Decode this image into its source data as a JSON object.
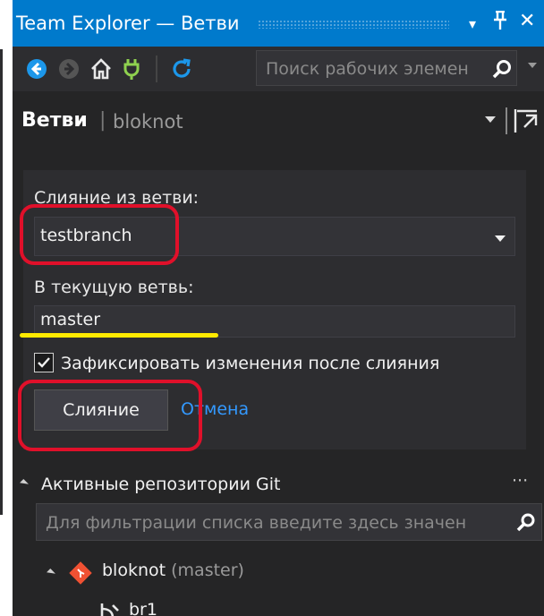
{
  "window": {
    "title": "Team Explorer — Ветви",
    "dropdown_glyph": "▾",
    "pin_glyph": "ᚋ",
    "close_glyph": "✕"
  },
  "toolbar": {
    "search_placeholder": "Поиск рабочих элемен",
    "icons": [
      "back-icon",
      "forward-icon",
      "home-icon",
      "connect-icon",
      "refresh-icon",
      "search-icon"
    ]
  },
  "header": {
    "page_title": "Ветви",
    "separator": "|",
    "repository": "bloknot"
  },
  "merge": {
    "from_label": "Слияние из ветви:",
    "from_value": "testbranch",
    "into_label": "В текущую ветвь:",
    "into_value": "master",
    "commit_checkbox_label": "Зафиксировать изменения после слияния",
    "commit_checked": true,
    "merge_button": "Слияние",
    "cancel_link": "Отмена"
  },
  "repositories": {
    "title": "Активные репозитории Git",
    "more": "···",
    "filter_placeholder": "Для фильтрации списка введите здесь значен",
    "items": [
      {
        "name": "bloknot",
        "current_branch": "(master)"
      }
    ],
    "branches": [
      "br1"
    ]
  },
  "colors": {
    "accent": "#007acc",
    "background": "#252526",
    "link": "#3399ff",
    "annotation_red": "#e0102a",
    "annotation_yellow": "#ffea00"
  }
}
